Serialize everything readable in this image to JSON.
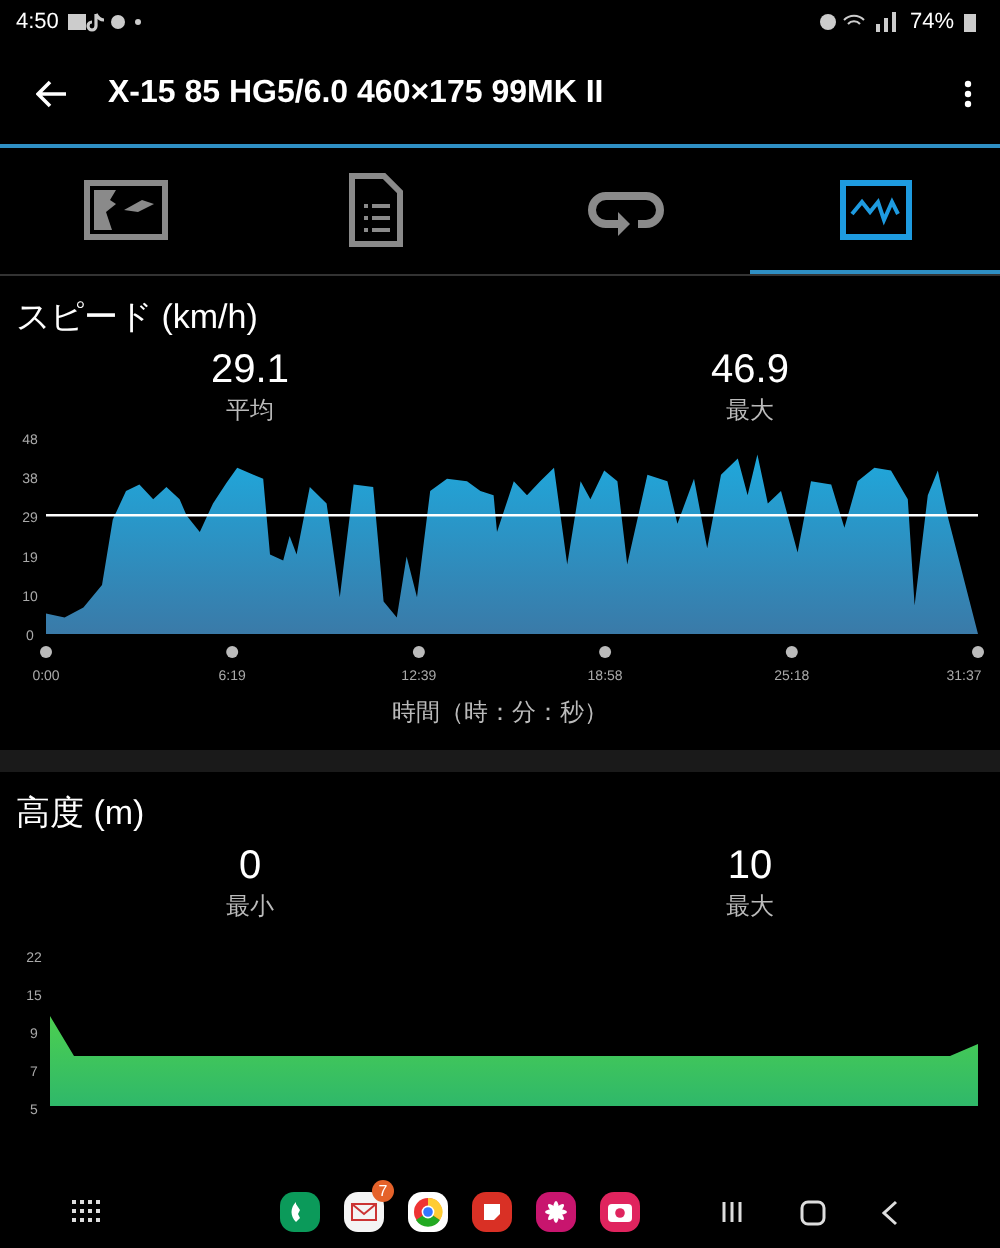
{
  "status_bar": {
    "time": "4:50",
    "battery": "74%"
  },
  "app_bar": {
    "title": "X-15 85 HG5/6.0 460×175 99MK II"
  },
  "tabs": [
    {
      "selected": false
    },
    {
      "selected": false
    },
    {
      "selected": false
    },
    {
      "selected": true
    }
  ],
  "speed": {
    "title": "スピード (km/h)",
    "stats": [
      {
        "value": "29.1",
        "label": "平均"
      },
      {
        "value": "46.9",
        "label": "最大"
      }
    ],
    "axis_title": "時間（時：分：秒）",
    "chart_data": {
      "type": "area",
      "x": [
        0,
        38,
        76,
        114,
        136,
        163,
        190,
        218,
        245,
        272,
        286,
        313,
        340,
        367,
        389,
        422,
        442,
        456,
        483,
        496,
        510,
        537,
        571,
        598,
        626,
        666,
        687,
        714,
        734,
        755,
        782,
        816,
        857,
        884,
        911,
        918,
        952,
        979,
        1006,
        1034,
        1061,
        1088,
        1108,
        1136,
        1163,
        1183,
        1224,
        1265,
        1285,
        1319,
        1346,
        1374,
        1408,
        1428,
        1448,
        1469,
        1496,
        1530,
        1557,
        1598,
        1625,
        1652,
        1686,
        1720,
        1754,
        1768,
        1795,
        1815,
        1836,
        1897
      ],
      "series": [
        {
          "color": "#1fa8dc",
          "values": [
            5,
            4,
            6.5,
            12,
            28,
            35,
            36.6,
            33,
            36,
            33,
            29,
            25,
            32,
            37,
            40.7,
            39,
            38,
            19.5,
            18,
            24,
            19.5,
            36,
            32,
            9,
            36.6,
            36,
            8,
            4,
            19,
            9,
            35,
            38,
            37.4,
            35,
            34,
            25,
            37.4,
            34,
            37.4,
            40.7,
            17,
            37.4,
            33,
            40,
            37.4,
            17,
            39,
            37.4,
            27,
            38,
            21,
            39,
            43,
            34,
            44,
            32,
            35,
            20,
            37.4,
            36.6,
            26,
            37.4,
            40.7,
            40,
            33,
            7,
            34,
            40,
            28.5,
            0
          ]
        }
      ],
      "xlim": [
        0,
        1897
      ],
      "ylim": [
        0,
        48
      ],
      "xticks": [
        {
          "value": 0,
          "label": "0:00"
        },
        {
          "value": 379,
          "label": "6:19"
        },
        {
          "value": 759,
          "label": "12:39"
        },
        {
          "value": 1138,
          "label": "18:58"
        },
        {
          "value": 1518,
          "label": "25:18"
        },
        {
          "value": 1897,
          "label": "31:37"
        }
      ],
      "yticks": [
        {
          "value": 0,
          "label": "0"
        },
        {
          "value": 9.6,
          "label": "10"
        },
        {
          "value": 19.2,
          "label": "19"
        },
        {
          "value": 28.8,
          "label": "29"
        },
        {
          "value": 38.4,
          "label": "38"
        },
        {
          "value": 48,
          "label": "48"
        }
      ]
    }
  },
  "altitude": {
    "title": "高度 (m)",
    "stats": [
      {
        "value": "0",
        "label": "最小"
      },
      {
        "value": "10",
        "label": "最大"
      }
    ],
    "y_tick_labels": [
      "22",
      "15",
      "9",
      "7",
      "5"
    ]
  },
  "nav_bar": {
    "mail_badge": "7"
  }
}
